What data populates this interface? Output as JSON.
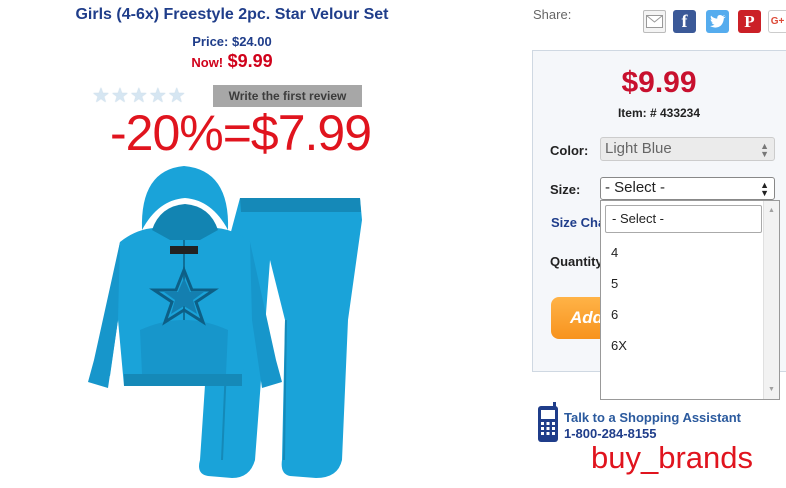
{
  "product": {
    "title": "Girls (4-6x) Freestyle 2pc. Star Velour Set",
    "price_line": "Price: $24.00",
    "now_label": "Now!",
    "now_price": "$9.99",
    "rating_stars_filled": 0,
    "rating_stars_total": 5,
    "review_button": "Write the first review",
    "image_alt": "Blue velour hoodie and pants set with star design"
  },
  "overlay": {
    "promo_text": "-20%=$7.99",
    "watermark": "buy_brands"
  },
  "share": {
    "label": "Share:",
    "icons": [
      "mail-icon",
      "facebook-icon",
      "twitter-icon",
      "pinterest-icon",
      "google-plus-icon"
    ],
    "facebook_glyph": "f",
    "pinterest_glyph": "P",
    "gplus_glyph": "G+"
  },
  "panel": {
    "price": "$9.99",
    "item_number": "Item: # 433234",
    "color_label": "Color:",
    "color_value": "Light Blue",
    "size_label": "Size:",
    "size_value": "- Select -",
    "size_chart_link": "Size Cha",
    "quantity_label": "Quantity",
    "add_button": "Add"
  },
  "size_dropdown": {
    "search_value": "- Select -",
    "options": [
      "4",
      "5",
      "6",
      "6X"
    ]
  },
  "assistant": {
    "title": "Talk to a Shopping Assistant",
    "phone": "1-800-284-8155"
  },
  "colors": {
    "title_blue": "#1f3d8a",
    "sale_red": "#c8102e",
    "promo_red": "#e0141e",
    "product_blue": "#1aa3d9",
    "add_orange": "#f7931e"
  }
}
